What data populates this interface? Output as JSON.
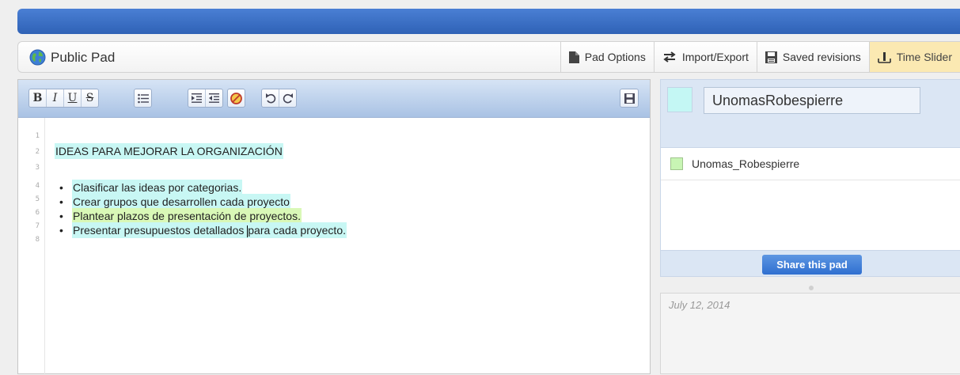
{
  "pad": {
    "title": "Public Pad"
  },
  "padbar_buttons": [
    {
      "label": "Pad Options",
      "icon": "document-icon"
    },
    {
      "label": "Import/Export",
      "icon": "arrows-icon"
    },
    {
      "label": "Saved revisions",
      "icon": "floppy-icon"
    },
    {
      "label": "Time Slider",
      "icon": "time-slider-icon"
    }
  ],
  "toolbar": {
    "bold": "B",
    "italic": "I",
    "underline": "U",
    "strike": "S"
  },
  "editor": {
    "line_numbers": [
      "1",
      "2",
      "3",
      "4",
      "5",
      "6",
      "7",
      "8"
    ],
    "heading": "IDEAS PARA MEJORAR LA ORGANIZACIÓN",
    "bullet_char": "•",
    "items": [
      "Clasificar las ideas por categorias.",
      "Crear grupos que desarrollen cada proyecto",
      "Plantear plazos de presentación de proyectos.",
      "Presentar presupuestos detallados "
    ],
    "item4_rest": "para cada proyecto."
  },
  "users": {
    "my_name": "UnomasRobespierre",
    "list": [
      {
        "name": "Unomas_Robespierre"
      }
    ],
    "share_label": "Share this pad"
  },
  "chat": {
    "date": "July 12, 2014"
  },
  "colors": {
    "my_color": "#c4f7f4",
    "user_color": "#c8f5b4",
    "highlight_cyan": "#c8f7f4",
    "highlight_green": "#d9f8b7",
    "topbar": "#2f62b6"
  }
}
